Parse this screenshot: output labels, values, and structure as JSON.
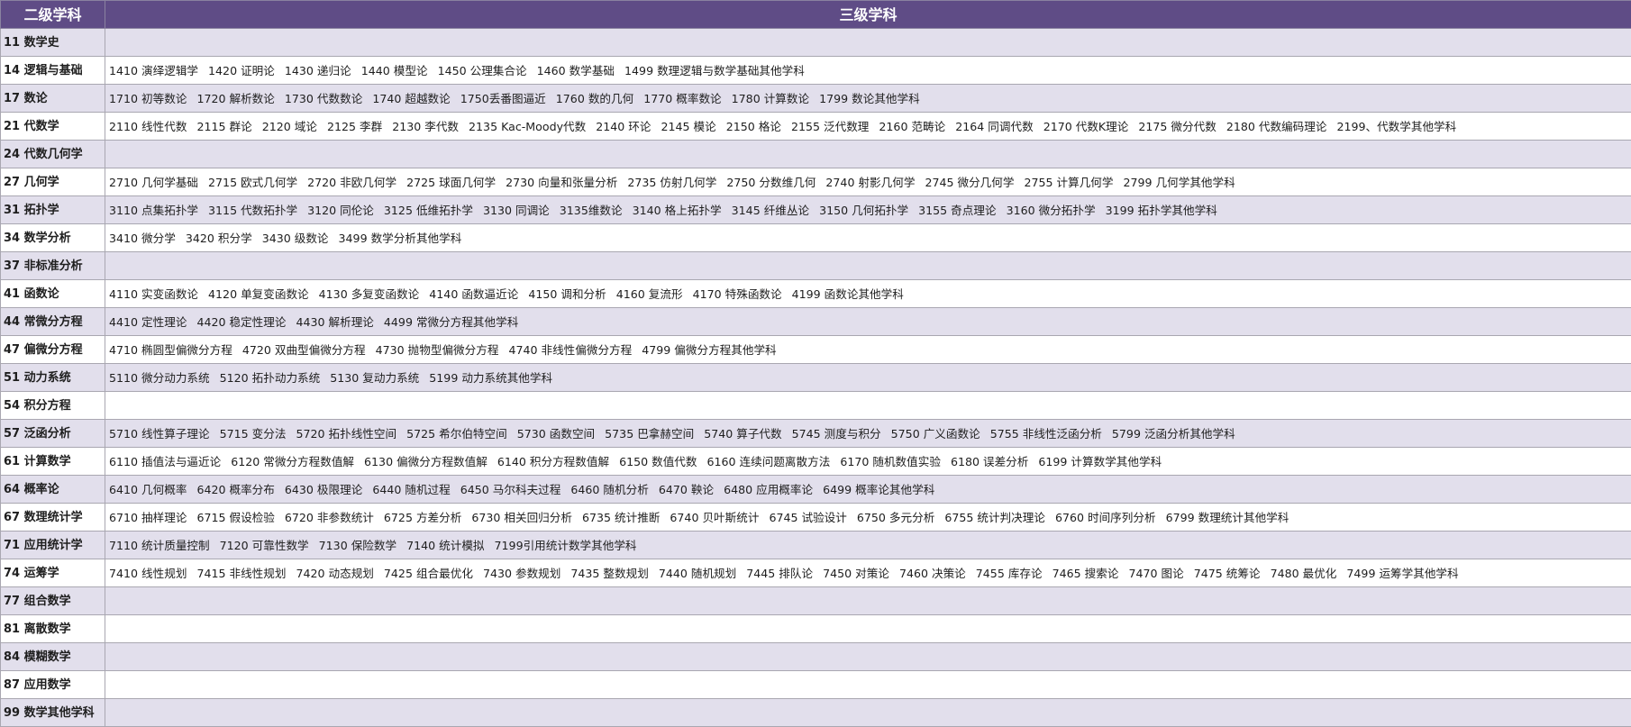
{
  "header": {
    "level2": "二级学科",
    "level3": "三级学科"
  },
  "rows": [
    {
      "level2": "11 数学史",
      "level3": []
    },
    {
      "level2": "14 逻辑与基础",
      "level3": [
        "1410 演绎逻辑学",
        "1420 证明论",
        "1430 递归论",
        "1440 模型论",
        "1450 公理集合论",
        "1460 数学基础",
        "1499 数理逻辑与数学基础其他学科"
      ]
    },
    {
      "level2": "17 数论",
      "level3": [
        "1710 初等数论",
        "1720 解析数论",
        "1730 代数数论",
        "1740 超越数论",
        "1750丢番图逼近",
        "1760 数的几何",
        "1770 概率数论",
        "1780 计算数论",
        "1799 数论其他学科"
      ]
    },
    {
      "level2": "21 代数学",
      "level3": [
        "2110 线性代数",
        "2115 群论",
        "2120 域论",
        "2125 李群",
        "2130 李代数",
        "2135 Kac-Moody代数",
        "2140 环论",
        "2145 模论",
        "2150 格论",
        "2155 泛代数理",
        "2160 范畴论",
        "2164 同调代数",
        "2170 代数K理论",
        "2175 微分代数",
        "2180 代数编码理论",
        "2199、代数学其他学科"
      ]
    },
    {
      "level2": "24 代数几何学",
      "level3": []
    },
    {
      "level2": "27 几何学",
      "level3": [
        "2710 几何学基础",
        "2715 欧式几何学",
        "2720 非欧几何学",
        "2725 球面几何学",
        "2730 向量和张量分析",
        "2735 仿射几何学",
        "2750 分数维几何",
        "2740 射影几何学",
        "2745 微分几何学",
        "2755 计算几何学",
        "2799 几何学其他学科"
      ]
    },
    {
      "level2": "31 拓扑学",
      "level3": [
        "3110 点集拓扑学",
        "3115 代数拓扑学",
        "3120 同伦论",
        "3125 低维拓扑学",
        "3130 同调论",
        "3135维数论",
        "3140 格上拓扑学",
        "3145 纤维丛论",
        "3150 几何拓扑学",
        "3155 奇点理论",
        "3160 微分拓扑学",
        "3199 拓扑学其他学科"
      ]
    },
    {
      "level2": "34 数学分析",
      "level3": [
        "3410 微分学",
        "3420 积分学",
        "3430 级数论",
        "3499 数学分析其他学科"
      ]
    },
    {
      "level2": "37 非标准分析",
      "level3": []
    },
    {
      "level2": "41 函数论",
      "level3": [
        "4110 实变函数论",
        "4120 单复变函数论",
        "4130 多复变函数论",
        "4140 函数逼近论",
        "4150 调和分析",
        "4160 复流形",
        "4170 特殊函数论",
        "4199 函数论其他学科"
      ]
    },
    {
      "level2": "44 常微分方程",
      "level3": [
        "4410 定性理论",
        "4420 稳定性理论",
        "4430 解析理论",
        "4499 常微分方程其他学科"
      ]
    },
    {
      "level2": "47 偏微分方程",
      "level3": [
        "4710 椭圆型偏微分方程",
        "4720 双曲型偏微分方程",
        "4730 抛物型偏微分方程",
        "4740 非线性偏微分方程",
        "4799 偏微分方程其他学科"
      ]
    },
    {
      "level2": "51 动力系统",
      "level3": [
        "5110 微分动力系统",
        "5120 拓扑动力系统",
        "5130 复动力系统",
        "5199 动力系统其他学科"
      ]
    },
    {
      "level2": "54 积分方程",
      "level3": []
    },
    {
      "level2": "57 泛函分析",
      "level3": [
        "5710 线性算子理论",
        "5715 变分法",
        "5720 拓扑线性空间",
        "5725 希尔伯特空间",
        "5730 函数空间",
        "5735 巴拿赫空间",
        "5740 算子代数",
        "5745 测度与积分",
        "5750 广义函数论",
        "5755 非线性泛函分析",
        "5799 泛函分析其他学科"
      ]
    },
    {
      "level2": "61 计算数学",
      "level3": [
        "6110 插值法与逼近论",
        "6120 常微分方程数值解",
        "6130 偏微分方程数值解",
        "6140 积分方程数值解",
        "6150 数值代数",
        "6160 连续问题离散方法",
        "6170 随机数值实验",
        "6180 误差分析",
        "6199 计算数学其他学科"
      ]
    },
    {
      "level2": "64 概率论",
      "level3": [
        "6410 几何概率",
        "6420 概率分布",
        "6430 极限理论",
        "6440 随机过程",
        "6450 马尔科夫过程",
        "6460 随机分析",
        "6470 鞅论",
        "6480 应用概率论",
        "6499 概率论其他学科"
      ]
    },
    {
      "level2": "67 数理统计学",
      "level3": [
        "6710 抽样理论",
        "6715 假设检验",
        "6720 非参数统计",
        "6725 方差分析",
        "6730 相关回归分析",
        "6735 统计推断",
        "6740 贝叶斯统计",
        "6745 试验设计",
        "6750 多元分析",
        "6755 统计判决理论",
        "6760 时间序列分析",
        "6799 数理统计其他学科"
      ]
    },
    {
      "level2": "71 应用统计学",
      "level3": [
        "7110 统计质量控制",
        "7120 可靠性数学",
        "7130 保险数学",
        "7140 统计模拟",
        "7199引用统计数学其他学科"
      ]
    },
    {
      "level2": "74 运筹学",
      "level3": [
        "7410 线性规划",
        "7415 非线性规划",
        "7420 动态规划",
        "7425 组合最优化",
        "7430 参数规划",
        "7435 整数规划",
        "7440 随机规划",
        "7445 排队论",
        "7450 对策论",
        "7460 决策论",
        "7455 库存论",
        "7465 搜索论",
        "7470 图论",
        "7475 统筹论",
        "7480 最优化",
        "7499 运筹学其他学科"
      ]
    },
    {
      "level2": "77 组合数学",
      "level3": []
    },
    {
      "level2": "81 离散数学",
      "level3": []
    },
    {
      "level2": "84 模糊数学",
      "level3": []
    },
    {
      "level2": "87 应用数学",
      "level3": []
    },
    {
      "level2": "99 数学其他学科",
      "level3": []
    }
  ]
}
